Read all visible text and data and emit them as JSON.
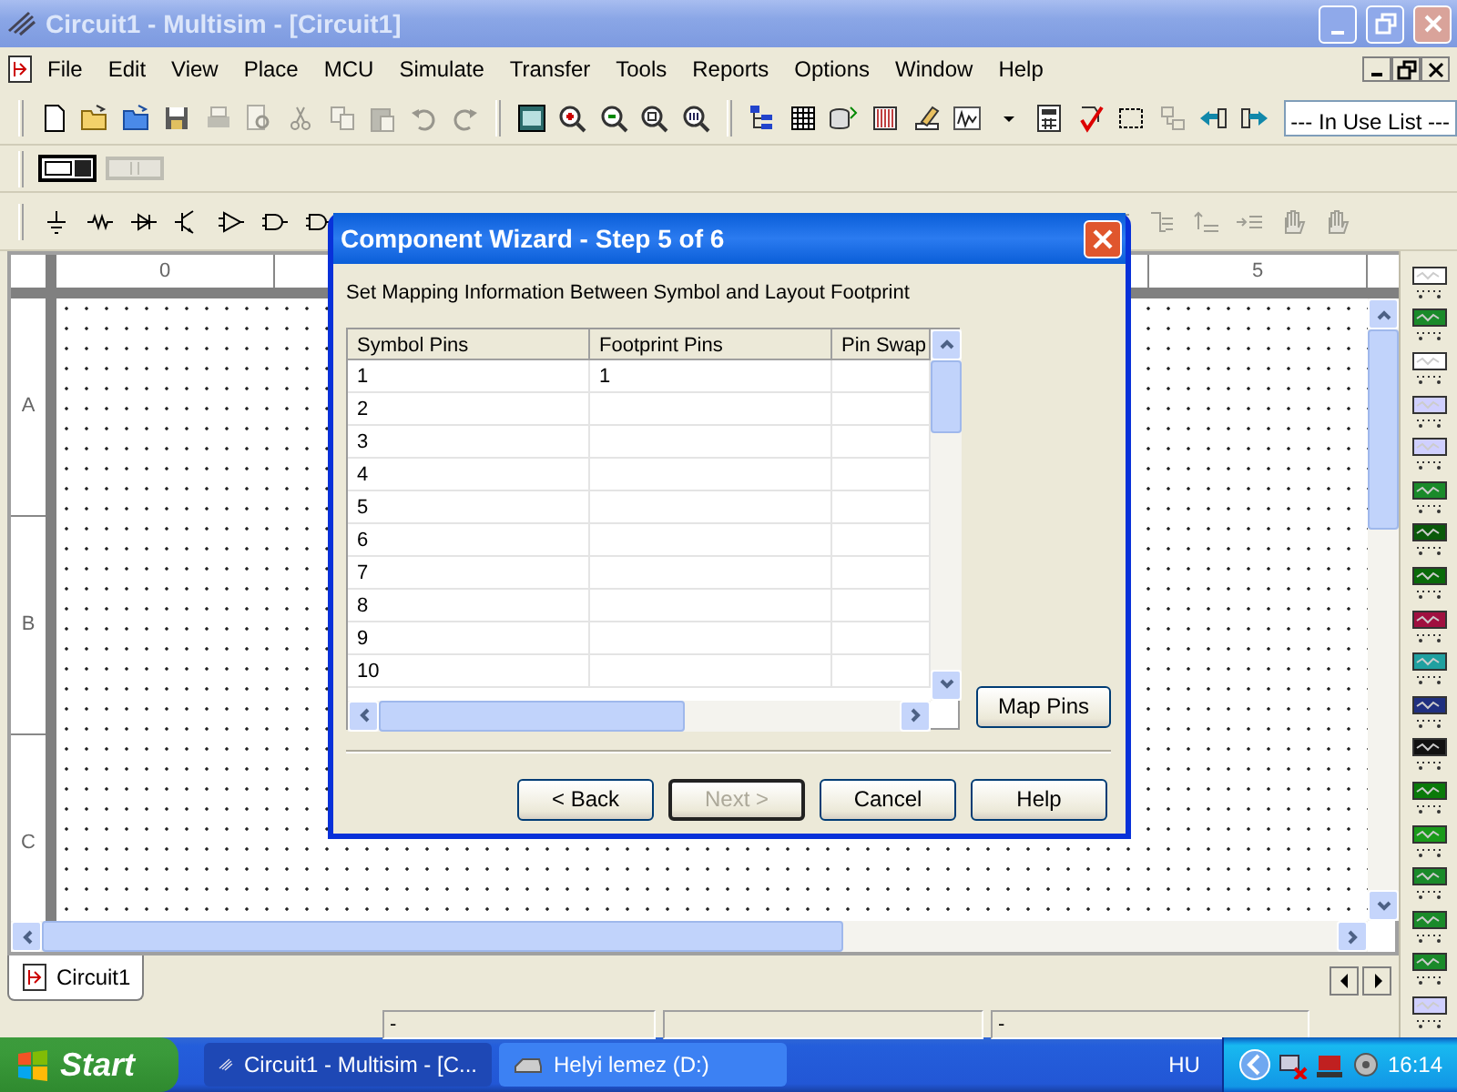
{
  "window": {
    "title": "Circuit1 - Multisim - [Circuit1]"
  },
  "menu": [
    "File",
    "Edit",
    "View",
    "Place",
    "MCU",
    "Simulate",
    "Transfer",
    "Tools",
    "Reports",
    "Options",
    "Window",
    "Help"
  ],
  "main_toolbar": [
    {
      "kind": "new",
      "disabled": false
    },
    {
      "kind": "open",
      "disabled": false
    },
    {
      "kind": "open-samples",
      "disabled": false
    },
    {
      "kind": "save",
      "disabled": false
    },
    {
      "kind": "print",
      "disabled": true
    },
    {
      "kind": "preview",
      "disabled": true
    },
    {
      "kind": "cut",
      "disabled": true
    },
    {
      "kind": "copy",
      "disabled": true
    },
    {
      "kind": "paste",
      "disabled": true
    },
    {
      "kind": "undo",
      "disabled": true
    },
    {
      "kind": "redo",
      "disabled": true
    },
    {
      "kind": "separator"
    },
    {
      "kind": "fullscreen",
      "disabled": false
    },
    {
      "kind": "zoom-in",
      "disabled": false
    },
    {
      "kind": "zoom-out",
      "disabled": false
    },
    {
      "kind": "zoom-area",
      "disabled": false
    },
    {
      "kind": "zoom-fit",
      "disabled": false
    },
    {
      "kind": "separator"
    },
    {
      "kind": "tree",
      "disabled": false
    },
    {
      "kind": "grid",
      "disabled": false
    },
    {
      "kind": "database",
      "disabled": false
    },
    {
      "kind": "spreadsheet",
      "disabled": false
    },
    {
      "kind": "pencil",
      "disabled": false
    },
    {
      "kind": "graph",
      "disabled": false
    },
    {
      "kind": "dropdown",
      "disabled": false
    },
    {
      "kind": "calculator",
      "disabled": false
    },
    {
      "kind": "check",
      "disabled": false
    },
    {
      "kind": "select",
      "disabled": false
    },
    {
      "kind": "link",
      "disabled": true
    },
    {
      "kind": "back",
      "disabled": false
    },
    {
      "kind": "forward",
      "disabled": false
    }
  ],
  "in_use_list": {
    "value": "--- In Use List ---"
  },
  "simulate_toolbar": [
    {
      "kind": "switch",
      "disabled": false
    },
    {
      "kind": "pause",
      "disabled": true
    }
  ],
  "place_toolbar": [
    {
      "kind": "source",
      "disabled": false
    },
    {
      "kind": "resistor",
      "disabled": false
    },
    {
      "kind": "diode",
      "disabled": false
    },
    {
      "kind": "transistor",
      "disabled": false
    },
    {
      "kind": "opamp",
      "disabled": false
    },
    {
      "kind": "gate",
      "disabled": false
    },
    {
      "kind": "gate",
      "disabled": false
    }
  ],
  "description_toolbar": [
    {
      "kind": "list",
      "disabled": true
    },
    {
      "kind": "list-loop",
      "disabled": true
    },
    {
      "kind": "list-up",
      "disabled": true
    },
    {
      "kind": "list-in",
      "disabled": true
    },
    {
      "kind": "hand",
      "disabled": true
    },
    {
      "kind": "hand",
      "disabled": true
    }
  ],
  "ruler": {
    "columns": [
      "0",
      "5"
    ],
    "rows": [
      "A",
      "B",
      "C"
    ]
  },
  "dialog": {
    "title": "Component Wizard - Step 5 of 6",
    "instruction": "Set Mapping Information Between Symbol and Layout Footprint",
    "columns": [
      "Symbol Pins",
      "Footprint Pins",
      "Pin Swap"
    ],
    "rows": [
      {
        "symbol_pin": "1",
        "footprint_pin": "1"
      },
      {
        "symbol_pin": "2"
      },
      {
        "symbol_pin": "3"
      },
      {
        "symbol_pin": "4"
      },
      {
        "symbol_pin": "5"
      },
      {
        "symbol_pin": "6"
      },
      {
        "symbol_pin": "7"
      },
      {
        "symbol_pin": "8"
      },
      {
        "symbol_pin": "9"
      },
      {
        "symbol_pin": "10"
      }
    ],
    "map_pins_button": "Map Pins",
    "buttons": [
      {
        "label": "< Back",
        "disabled": false,
        "default": false
      },
      {
        "label": "Next >",
        "disabled": true,
        "default": true
      },
      {
        "label": "Cancel",
        "disabled": false,
        "default": false
      },
      {
        "label": "Help",
        "disabled": false,
        "default": false
      }
    ]
  },
  "instruments": [
    {
      "kind": "multimeter"
    },
    {
      "kind": "generator"
    },
    {
      "kind": "wattmeter"
    },
    {
      "kind": "scope"
    },
    {
      "kind": "scope"
    },
    {
      "kind": "bode"
    },
    {
      "kind": "counter"
    },
    {
      "kind": "word"
    },
    {
      "kind": "analyzer"
    },
    {
      "kind": "converter"
    },
    {
      "kind": "iv"
    },
    {
      "kind": "distortion"
    },
    {
      "kind": "spectrum"
    },
    {
      "kind": "network"
    },
    {
      "kind": "agilent"
    },
    {
      "kind": "agilent"
    },
    {
      "kind": "agilent"
    },
    {
      "kind": "scope"
    }
  ],
  "tabs": [
    {
      "label": "Circuit1",
      "selected": true
    }
  ],
  "status_bar": [
    "-",
    "-"
  ],
  "taskbar": {
    "start": "Start",
    "tasks": [
      {
        "label": "Circuit1 - Multisim - [C...",
        "kind": "app",
        "selected": true
      },
      {
        "label": "Helyi lemez (D:)",
        "kind": "drive",
        "selected": false
      }
    ],
    "language": "HU",
    "clock": "16:14"
  }
}
